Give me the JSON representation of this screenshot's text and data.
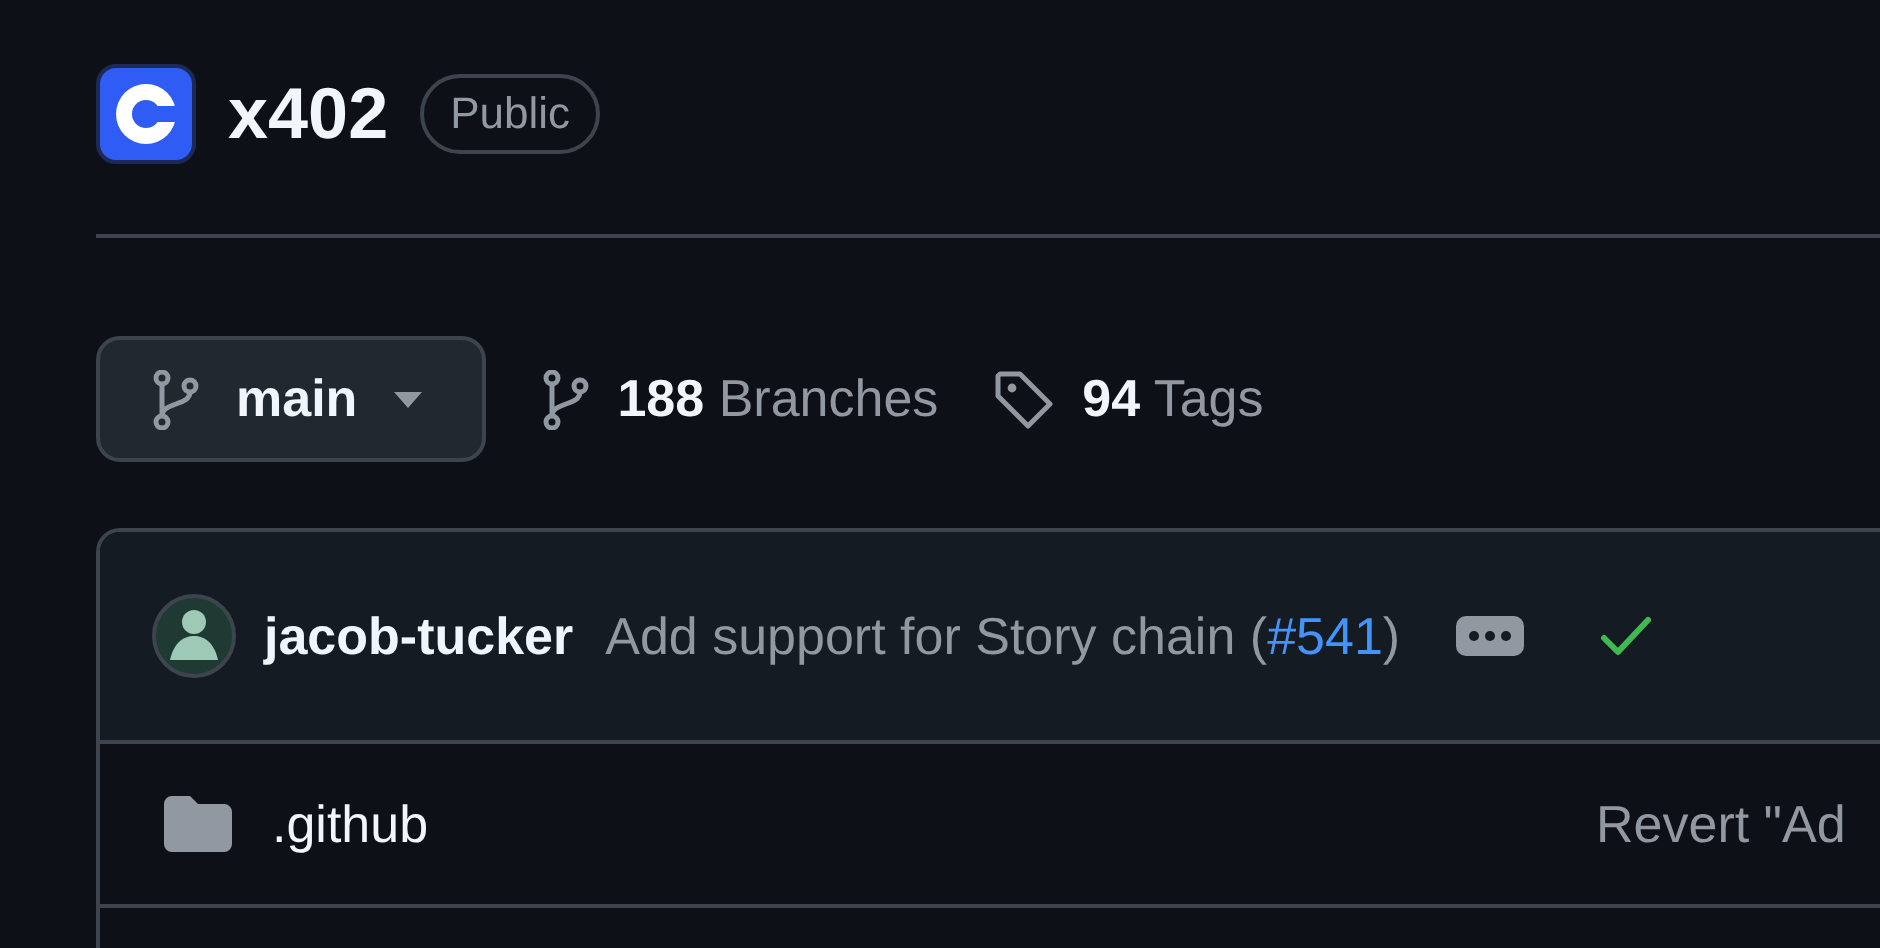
{
  "repo": {
    "name": "x402",
    "visibility": "Public"
  },
  "branch_selector": {
    "branch": "main"
  },
  "branches": {
    "count": "188",
    "label": "Branches"
  },
  "tags": {
    "count": "94",
    "label": "Tags"
  },
  "latest_commit": {
    "author": "jacob-tucker",
    "message": "Add support for Story chain (",
    "pr_link": "#541",
    "message_end": ")",
    "checks_passed": true
  },
  "files": [
    {
      "kind": "folder",
      "name": ".github",
      "last_commit": "Revert \"Ad"
    }
  ]
}
